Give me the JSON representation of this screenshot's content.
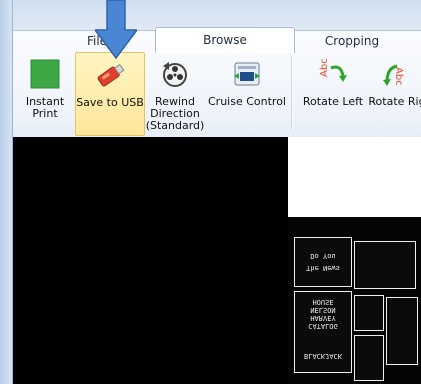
{
  "tabs": [
    {
      "label": "File"
    },
    {
      "label": "Browse"
    },
    {
      "label": "Cropping"
    }
  ],
  "ribbon": {
    "buttons": [
      {
        "label": "Instant\nPrint",
        "icon": "print-icon"
      },
      {
        "label": "Save to USB",
        "icon": "usb-icon"
      },
      {
        "label": "Rewind\nDirection\n(Standard)",
        "icon": "film-reel-icon"
      },
      {
        "label": "Cruise Control",
        "icon": "cruise-control-icon"
      },
      {
        "label": "Rotate Left",
        "icon": "rotate-left-icon",
        "badge": "Abc"
      },
      {
        "label": "Rotate Rig",
        "icon": "rotate-right-icon",
        "badge": "Abc"
      }
    ]
  },
  "colors": {
    "accent_arrow": "#4a86d3",
    "selected_bg": "#ffe79a",
    "green_icon": "#3ea845"
  },
  "document": {
    "cards": [
      "The News",
      "Do You",
      "HARVEY NELSON HOUSE",
      "CATALOG",
      "BLACKJACK"
    ]
  }
}
